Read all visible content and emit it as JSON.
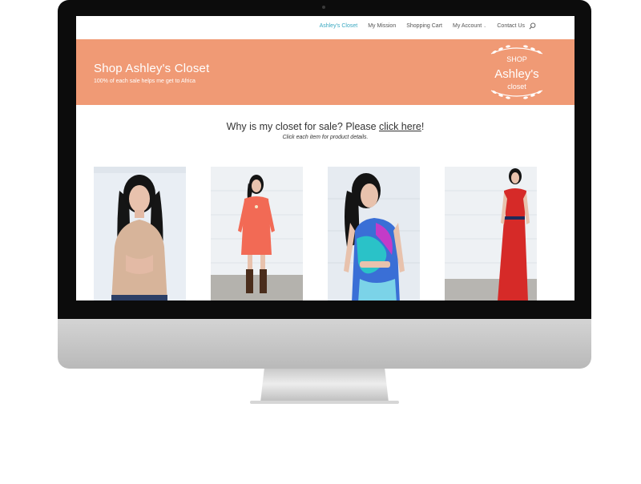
{
  "nav": {
    "items": [
      {
        "label": "Ashley's Closet",
        "active": true
      },
      {
        "label": "My Mission",
        "active": false
      },
      {
        "label": "Shopping Cart",
        "active": false
      },
      {
        "label": "My Account",
        "active": false,
        "has_dropdown": true
      },
      {
        "label": "Contact Us",
        "active": false
      }
    ],
    "search_icon": "search-icon",
    "active_color": "#3aa8c1"
  },
  "banner": {
    "title": "Shop Ashley's Closet",
    "subtitle": "100% of each sale helps me get to Africa",
    "background": "#f09a75",
    "logo": {
      "line1": "SHOP",
      "line2": "Ashley's",
      "line3": "closet"
    }
  },
  "main": {
    "headline_prefix": "Why is my closet for sale? Please ",
    "headline_link": "click here",
    "headline_suffix": "!",
    "subline": "Click each item for product details."
  },
  "products": [
    {
      "name": "tan-silk-blouse",
      "dress_color": "#d7b49a"
    },
    {
      "name": "coral-dress",
      "dress_color": "#f26a55"
    },
    {
      "name": "blue-print-dress",
      "dress_color": "#3a6fd6"
    },
    {
      "name": "red-maxi-dress",
      "dress_color": "#d62a28"
    }
  ]
}
